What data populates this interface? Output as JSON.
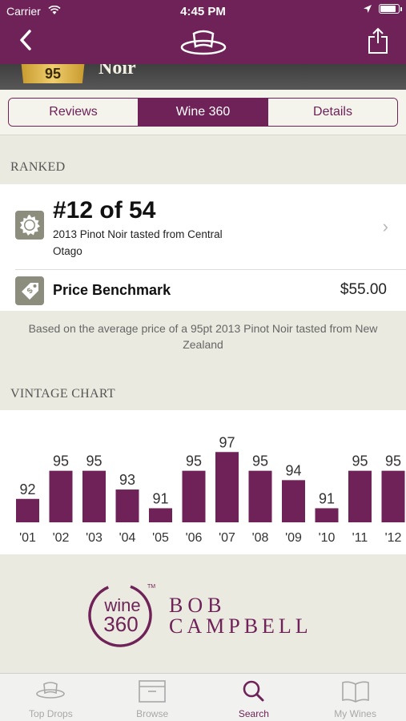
{
  "status_bar": {
    "carrier": "Carrier",
    "time": "4:45 PM"
  },
  "wine": {
    "score": "95",
    "name_fragment": "Noir"
  },
  "tabs": [
    {
      "label": "Reviews",
      "active": false
    },
    {
      "label": "Wine 360",
      "active": true
    },
    {
      "label": "Details",
      "active": false
    }
  ],
  "ranked": {
    "section_title": "RANKED",
    "rank": "#12 of 54",
    "description": "2013 Pinot Noir tasted from Central Otago",
    "price_label": "Price Benchmark",
    "price_value": "$55.00",
    "note": "Based on the average price of a 95pt 2013 Pinot Noir tasted from New Zealand"
  },
  "vintage": {
    "section_title": "VINTAGE CHART"
  },
  "chart_data": {
    "type": "bar",
    "categories": [
      "'01",
      "'02",
      "'03",
      "'04",
      "'05",
      "'06",
      "'07",
      "'08",
      "'09",
      "'10",
      "'11",
      "'12"
    ],
    "values": [
      92,
      95,
      95,
      93,
      91,
      95,
      97,
      95,
      94,
      91,
      95,
      95
    ],
    "ylim": [
      90,
      97
    ],
    "bar_color": "#6e2258",
    "title": "",
    "xlabel": "",
    "ylabel": ""
  },
  "brand": {
    "badge_top": "wine",
    "badge_bottom": "360",
    "tm": "TM",
    "name_line1": "BOB",
    "name_line2": "CAMPBELL"
  },
  "tabbar": [
    {
      "label": "Top Drops",
      "icon": "hat-icon",
      "active": false
    },
    {
      "label": "Browse",
      "icon": "box-icon",
      "active": false
    },
    {
      "label": "Search",
      "icon": "search-icon",
      "active": true
    },
    {
      "label": "My Wines",
      "icon": "book-icon",
      "active": false
    }
  ],
  "colors": {
    "brand": "#6e2258",
    "gold": "#e1b94c",
    "background": "#ebeae0"
  }
}
